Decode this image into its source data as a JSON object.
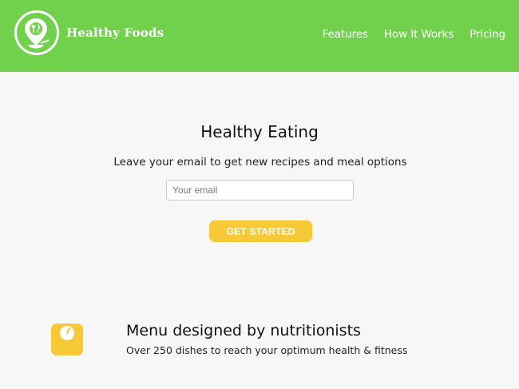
{
  "header": {
    "brand": "Healthy Foods",
    "logo_icon": "location-pin-fork-knife-icon",
    "nav": [
      "Features",
      "How It Works",
      "Pricing"
    ]
  },
  "hero": {
    "title": "Healthy Eating",
    "subtitle": "Leave your email to get new recipes and meal options",
    "email_placeholder": "Your email",
    "cta_label": "GET STARTED"
  },
  "features": [
    {
      "icon": "scale-icon",
      "title": "Menu designed by nutritionists",
      "description": "Over 250 dishes to reach your optimum health & fitness"
    }
  ],
  "colors": {
    "header_bg": "#72d14c",
    "accent": "#f7c937",
    "page_bg": "#f7f7f7"
  }
}
